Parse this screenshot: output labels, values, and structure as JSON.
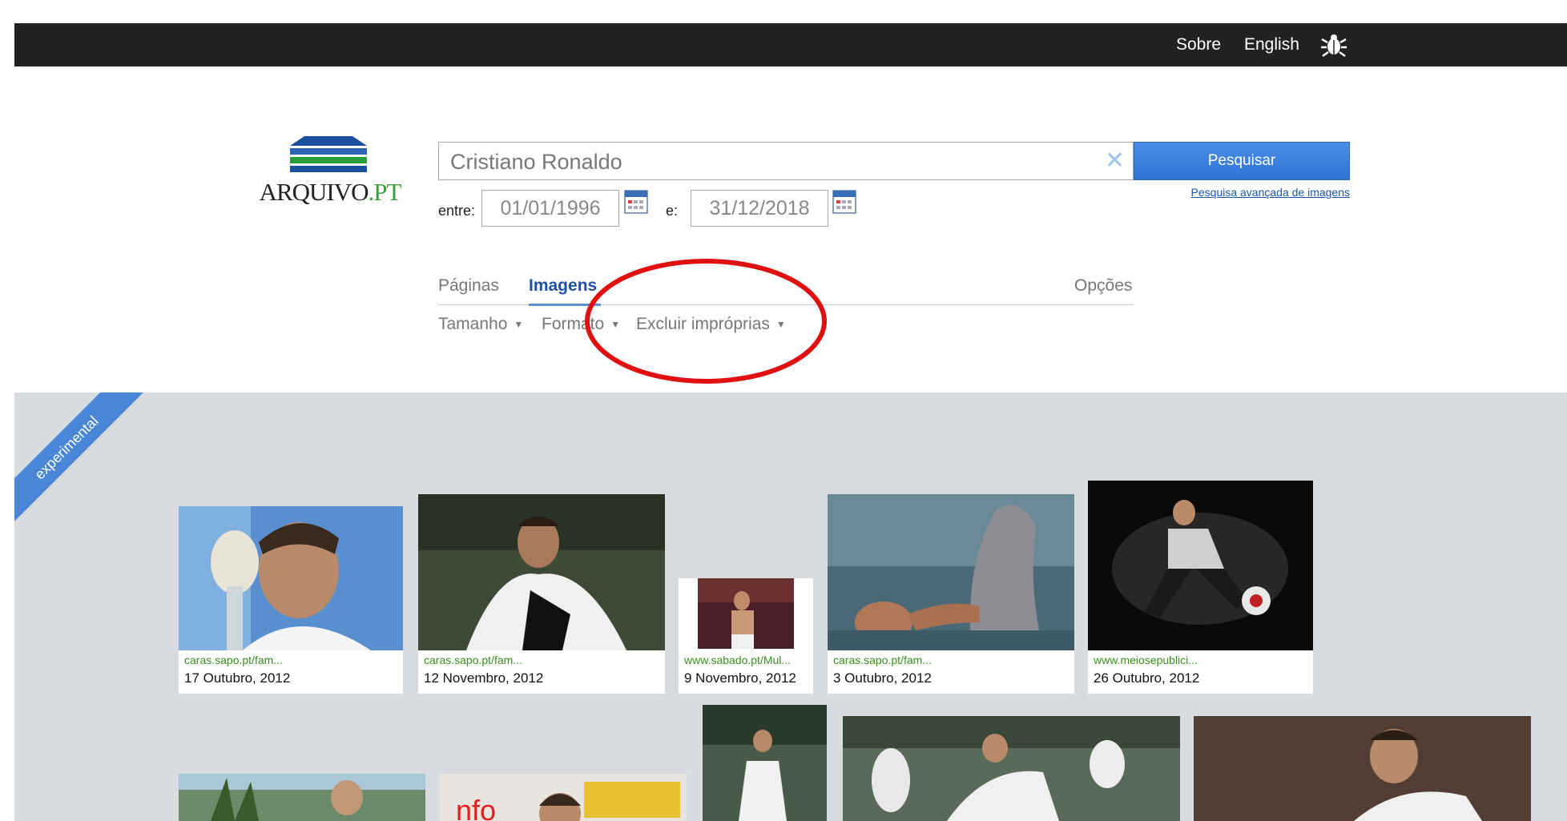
{
  "topbar": {
    "about": "Sobre",
    "language": "English",
    "bug_icon": "bug-icon"
  },
  "logo": {
    "text_main": "ARQUIVO",
    "text_dot": ".",
    "text_pt": "PT"
  },
  "search": {
    "value": "Cristiano Ronaldo",
    "button": "Pesquisar",
    "advanced": "Pesquisa avançada de imagens",
    "from_label": "entre:",
    "from_date": "01/01/1996",
    "to_label": "e:",
    "to_date": "31/12/2018"
  },
  "tabs": [
    {
      "label": "Páginas"
    },
    {
      "label": "Imagens"
    },
    {
      "label": "Opções"
    }
  ],
  "filters": [
    {
      "label": "Tamanho"
    },
    {
      "label": "Formato"
    },
    {
      "label": "Excluir impróprias"
    }
  ],
  "ribbon": "experimental",
  "results_row1": [
    {
      "source": "caras.sapo.pt/fam...",
      "date": "17 Outubro, 2012"
    },
    {
      "source": "caras.sapo.pt/fam...",
      "date": "12 Novembro, 2012"
    },
    {
      "source": "www.sabado.pt/Mul...",
      "date": "9 Novembro, 2012"
    },
    {
      "source": "caras.sapo.pt/fam...",
      "date": "3 Outubro, 2012"
    },
    {
      "source": "www.meiosepublici...",
      "date": "26 Outubro, 2012"
    }
  ],
  "colors": {
    "topbar": "#222222",
    "accent_blue": "#2f73d6",
    "source_green": "#3a8f1a",
    "results_bg": "#d8dce1",
    "annotation_red": "#e01010"
  }
}
